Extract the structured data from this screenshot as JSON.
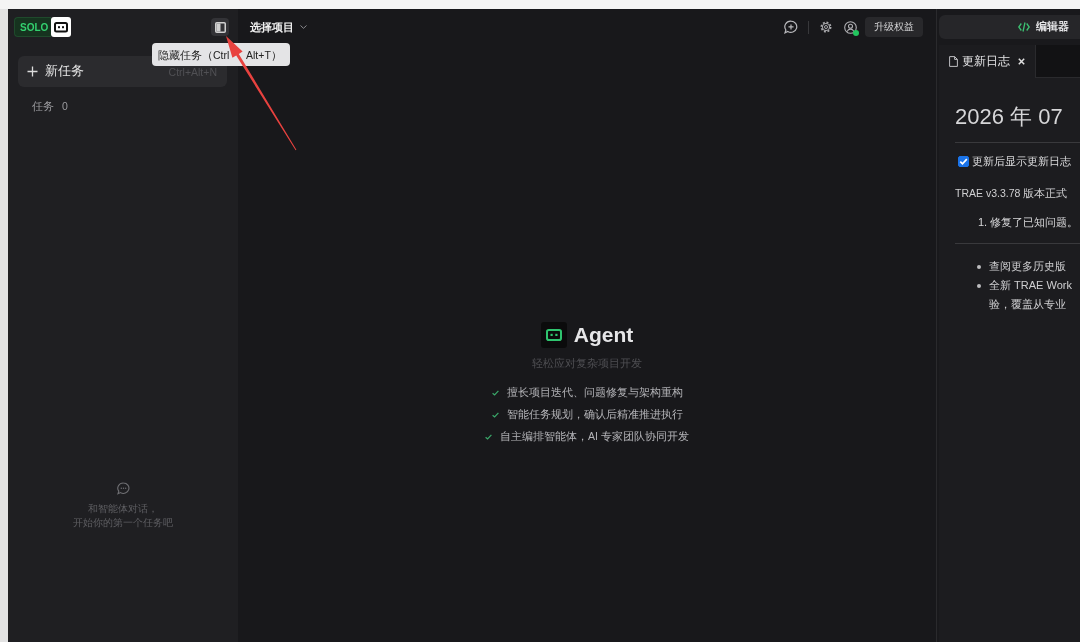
{
  "sidebar": {
    "logo": "SOLO",
    "tooltip": [
      "隐藏任务（Ctrl",
      "Alt+T）"
    ],
    "new_task": {
      "label": "新任务",
      "shortcut": "Ctrl+Alt+N"
    },
    "tasks": {
      "label": "任务",
      "count": "0"
    },
    "empty_hint": [
      "和智能体对话，",
      "开始你的第一个任务吧"
    ]
  },
  "toolbar": {
    "project_picker": "选择项目",
    "user_online": true,
    "upgrade_button": "升级权益"
  },
  "agent": {
    "title": "Agent",
    "subtitle": "轻松应对复杂项目开发",
    "features": [
      "擅长项目迭代、问题修复与架构重构",
      "智能任务规划，确认后精准推进执行",
      "自主编排智能体，AI 专家团队协同开发"
    ]
  },
  "editor_panel": {
    "editor_button": "编辑器",
    "tabs": [
      {
        "label": "更新日志",
        "selected": true
      }
    ],
    "changelog": {
      "heading": "2026 年 07",
      "show_after_update": {
        "label": "更新后显示更新日志",
        "checked": true
      },
      "intro": "TRAE v3.3.78 版本正式",
      "items": [
        "1. 修复了已知问题。"
      ],
      "bullets": [
        {
          "lines": [
            "查阅更多历史版"
          ]
        },
        {
          "lines": [
            "全新 TRAE Work",
            "验，覆盖从专业"
          ]
        }
      ]
    }
  }
}
